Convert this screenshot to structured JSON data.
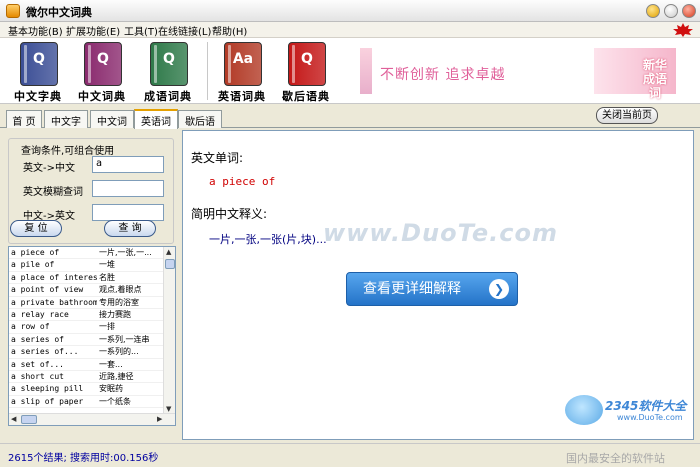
{
  "window": {
    "title": "微尔中文词典"
  },
  "menu": [
    "基本功能(B)",
    "扩展功能(E)",
    "工具(T)",
    "在线链接(L)",
    "帮助(H)"
  ],
  "toolbar": {
    "buttons": [
      {
        "label": "中文字典",
        "icon": "dictionary-book-icon",
        "color": "#3c4f96",
        "glyph": "Q"
      },
      {
        "label": "中文词典",
        "icon": "dictionary-book-icon",
        "color": "#8a2a6e",
        "glyph": "Q"
      },
      {
        "label": "成语词典",
        "icon": "idiom-book-icon",
        "color": "#2f7a4a",
        "glyph": "Q"
      },
      {
        "label": "英语词典",
        "icon": "english-book-icon",
        "color": "#b23a26",
        "glyph": "Aa"
      },
      {
        "label": "歇后语典",
        "icon": "xiehouyu-book-icon",
        "color": "#c41818",
        "glyph": "Q"
      }
    ],
    "banner_text": "不断创新 追求卓越",
    "banner2_text": "新华成语词"
  },
  "tabs": [
    {
      "label": "首 页",
      "active": false
    },
    {
      "label": "中文字典",
      "active": false
    },
    {
      "label": "中文词典",
      "active": false
    },
    {
      "label": "英语词典",
      "active": true
    },
    {
      "label": "歇后语典",
      "active": false
    }
  ],
  "close_page_label": "关闭当前页",
  "query": {
    "legend": "查询条件,可组合使用",
    "fields": [
      {
        "label": "英文->中文",
        "value": "a"
      },
      {
        "label": "英文模糊查词",
        "value": ""
      },
      {
        "label": "中文->英文",
        "value": ""
      }
    ],
    "reset_label": "复 位",
    "search_label": "查 询"
  },
  "wordlist": [
    {
      "en": "a piece of",
      "zh": "一片,一张,一..."
    },
    {
      "en": "a pile of",
      "zh": "一堆"
    },
    {
      "en": "a place of interest",
      "zh": "名胜"
    },
    {
      "en": "a point of view",
      "zh": "观点,着眼点"
    },
    {
      "en": "a private bathroom",
      "zh": "专用的浴室"
    },
    {
      "en": "a relay race",
      "zh": "接力赛跑"
    },
    {
      "en": "a row of",
      "zh": "一排"
    },
    {
      "en": "a series of",
      "zh": "一系列,一连串"
    },
    {
      "en": "a series of...",
      "zh": "一系列的..."
    },
    {
      "en": "a set of...",
      "zh": "一套..."
    },
    {
      "en": "a short cut",
      "zh": "近路,捷径"
    },
    {
      "en": "a sleeping pill",
      "zh": "安眠药"
    },
    {
      "en": "a slip of paper",
      "zh": "一个纸条"
    }
  ],
  "entry": {
    "word_label": "英文单词:",
    "word": "a piece of",
    "meaning_label": "简明中文释义:",
    "meaning": "一片,一张,一张(片,块)...",
    "detail_button": "查看更详细解释"
  },
  "watermark": "www.DuoTe.com",
  "brand": {
    "name": "2345软件大全",
    "url": "www.DuoTe.com"
  },
  "status": {
    "text": "2615个结果; 搜索用时:00.156秒",
    "corner": "国内最安全的软件站"
  }
}
